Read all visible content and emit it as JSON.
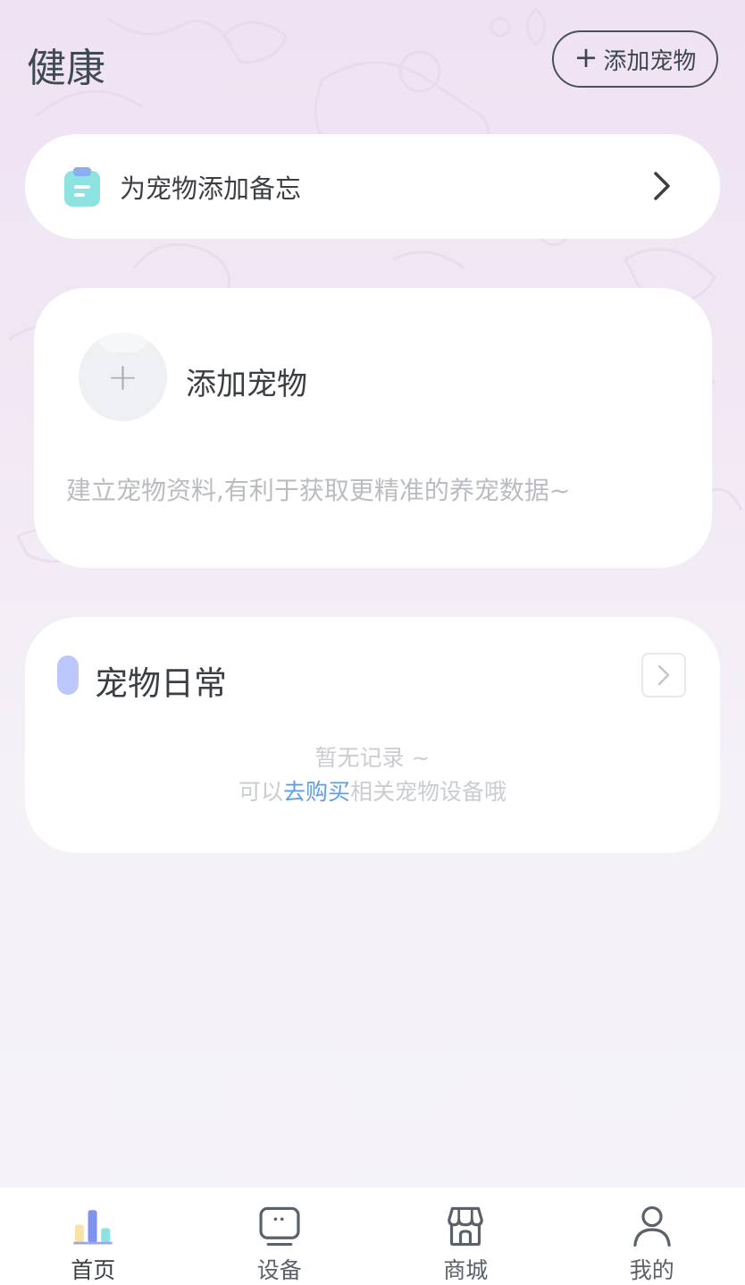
{
  "header": {
    "title": "健康",
    "add_pet_button": "添加宠物"
  },
  "memo": {
    "label": "为宠物添加备忘"
  },
  "pet_card": {
    "title": "添加宠物",
    "description": "建立宠物资料,有利于获取更精准的养宠数据~"
  },
  "daily": {
    "title": "宠物日常",
    "empty_text": "暂无记录 ~",
    "hint_prefix": "可以",
    "hint_link": "去购买",
    "hint_suffix": "相关宠物设备哦"
  },
  "tabbar": {
    "items": [
      {
        "label": "首页",
        "icon": "home-chart-icon",
        "active": true
      },
      {
        "label": "设备",
        "icon": "device-icon",
        "active": false
      },
      {
        "label": "商城",
        "icon": "shop-icon",
        "active": false
      },
      {
        "label": "我的",
        "icon": "profile-icon",
        "active": false
      }
    ]
  },
  "colors": {
    "accent_link": "#5c9ee9",
    "daily_mark": "#bcc7fb",
    "memo_icon": "#8de3e0"
  }
}
